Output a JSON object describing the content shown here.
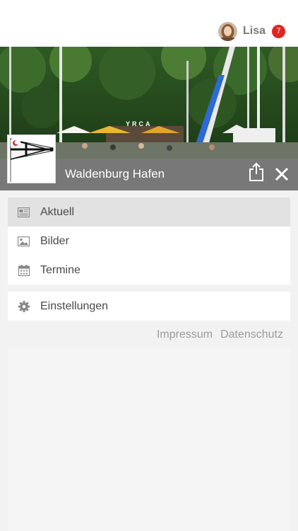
{
  "user": {
    "name": "Lisa",
    "badge_count": "7"
  },
  "header": {
    "title": "Waldenburg Hafen",
    "hero_sign": "YRCA"
  },
  "menu": [
    {
      "label": "Aktuell",
      "icon": "newspaper-icon",
      "active": true
    },
    {
      "label": "Bilder",
      "icon": "image-icon",
      "active": false
    },
    {
      "label": "Termine",
      "icon": "calendar-icon",
      "active": false
    }
  ],
  "settings": {
    "label": "Einstellungen",
    "icon": "gear-icon"
  },
  "footer_links": {
    "impressum": "Impressum",
    "datenschutz": "Datenschutz"
  },
  "colors": {
    "badge": "#e0241f",
    "title_bar": "#6e6e6e",
    "active_item": "#e2e2e2"
  }
}
